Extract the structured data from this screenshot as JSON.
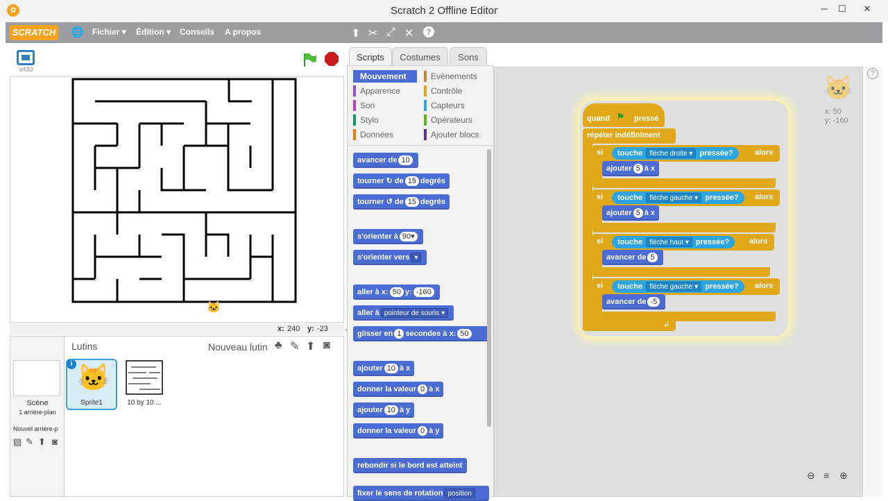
{
  "window": {
    "title": "Scratch 2 Offline Editor",
    "min": "─",
    "max": "☐",
    "close": "✕"
  },
  "menubar": {
    "logo": "SCRATCH",
    "items": [
      "Fichier ▾",
      "Édition ▾",
      "Conseils",
      "A propos"
    ],
    "tools": [
      "duplicate-icon",
      "delete-icon",
      "grow-icon",
      "shrink-icon",
      "help-icon"
    ]
  },
  "stage": {
    "version": "v433",
    "coords": {
      "x_label": "x:",
      "x": "240",
      "y_label": "y:",
      "y": "-23"
    }
  },
  "sprites": {
    "title": "Lutins",
    "new_sprite": "Nouveau lutin",
    "scene_label": "Scène",
    "scene_sub": "1 arrière-plan",
    "new_backdrop": "Nouvel arrière-p",
    "items": [
      {
        "name": "Sprite1",
        "selected": true
      },
      {
        "name": "10 by 10 ...",
        "selected": false
      }
    ]
  },
  "tabs": [
    "Scripts",
    "Costumes",
    "Sons"
  ],
  "categories": {
    "left": [
      {
        "label": "Mouvement",
        "color": "#4a6cd4",
        "active": true
      },
      {
        "label": "Apparence",
        "color": "#8a55d7"
      },
      {
        "label": "Son",
        "color": "#bb42c3"
      },
      {
        "label": "Stylo",
        "color": "#0e9a6c"
      },
      {
        "label": "Données",
        "color": "#ee7d16"
      }
    ],
    "right": [
      {
        "label": "Evènements",
        "color": "#c88330"
      },
      {
        "label": "Contrôle",
        "color": "#e1a91a"
      },
      {
        "label": "Capteurs",
        "color": "#2ca5e2"
      },
      {
        "label": "Opérateurs",
        "color": "#5cb712"
      },
      {
        "label": "Ajouter blocs",
        "color": "#632d99"
      }
    ]
  },
  "palette": {
    "b1": {
      "a": "avancer de",
      "v": "10"
    },
    "b2": {
      "a": "tourner",
      "b": "de",
      "v": "15",
      "c": "degrés"
    },
    "b3": {
      "a": "tourner",
      "b": "de",
      "v": "15",
      "c": "degrés"
    },
    "b4": {
      "a": "s'orienter à",
      "v": "90▾"
    },
    "b5": {
      "a": "s'orienter vers",
      "v": "▾"
    },
    "b6": {
      "a": "aller à x:",
      "v1": "50",
      "b": "y:",
      "v2": "-160"
    },
    "b7": {
      "a": "aller à",
      "v": "pointeur de souris ▾"
    },
    "b8": {
      "a": "glisser en",
      "v1": "1",
      "b": "secondes à x:",
      "v2": "50"
    },
    "b9": {
      "a": "ajouter",
      "v": "10",
      "b": "à x"
    },
    "b10": {
      "a": "donner la valeur",
      "v": "0",
      "b": "à x"
    },
    "b11": {
      "a": "ajouter",
      "v": "10",
      "b": "à y"
    },
    "b12": {
      "a": "donner la valeur",
      "v": "0",
      "b": "à y"
    },
    "b13": {
      "a": "rebondir si le bord est atteint"
    },
    "b14": {
      "a": "fixer le sens de rotation",
      "v": "position"
    }
  },
  "script": {
    "hat": {
      "a": "quand",
      "b": "pressé"
    },
    "forever": "répéter indéfiniment",
    "ifs": [
      {
        "si": "si",
        "touche": "touche",
        "key": "flèche droite ▾",
        "pressed": "pressée?",
        "alors": "alors",
        "cmd": "ajouter",
        "val": "5",
        "tail": "à x"
      },
      {
        "si": "si",
        "touche": "touche",
        "key": "flèche gauche ▾",
        "pressed": "pressée?",
        "alors": "alors",
        "cmd": "ajouter",
        "val": "5",
        "tail": "à x"
      },
      {
        "si": "si",
        "touche": "touche",
        "key": "flèche haut ▾",
        "pressed": "pressée?",
        "alors": "alors",
        "cmd": "avancer de",
        "val": "5",
        "tail": ""
      },
      {
        "si": "si",
        "touche": "touche",
        "key": "flèche gauche ▾",
        "pressed": "pressée?",
        "alors": "alors",
        "cmd": "avancer de",
        "val": "-5",
        "tail": ""
      }
    ]
  },
  "sprite_info": {
    "x_label": "x:",
    "x": "50",
    "y_label": "y:",
    "y": "-160"
  },
  "zoom": [
    "zoom-out-icon",
    "zoom-reset-icon",
    "zoom-in-icon"
  ]
}
